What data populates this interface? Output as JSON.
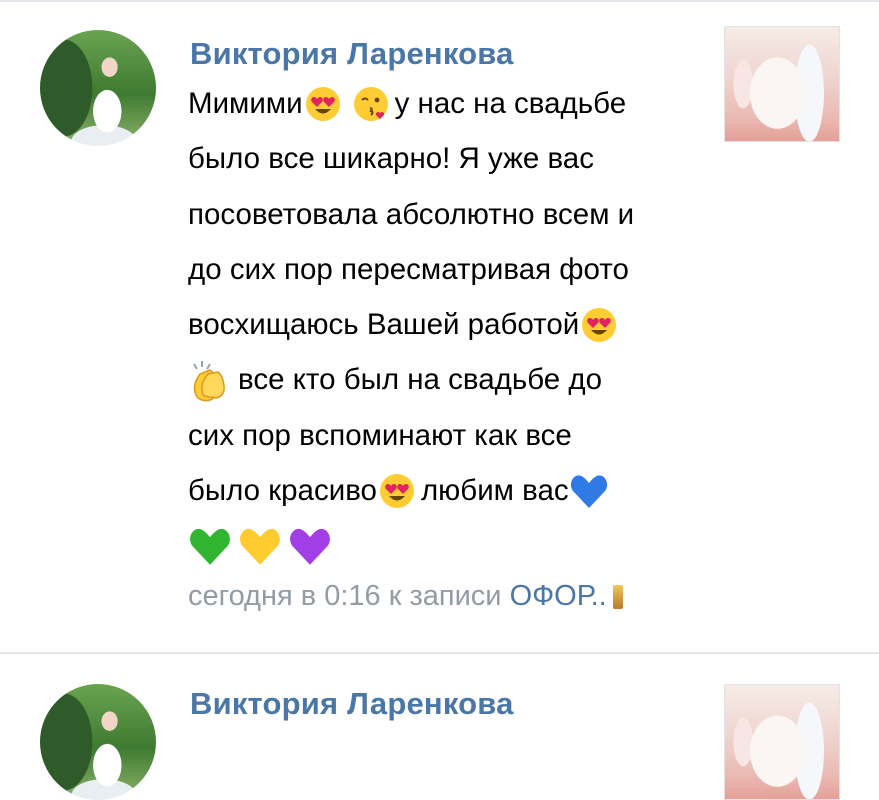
{
  "comments": [
    {
      "author": "Виктория Ларенкова",
      "lines": [
        [
          "Мимими",
          "",
          "",
          " у нас на свадьбе"
        ],
        [
          "было все шикарно! Я уже вас"
        ],
        [
          "посоветовала абсолютно всем и"
        ],
        [
          "до сих пор пересматривая фото"
        ],
        [
          "восхищаюсь Вашей работой"
        ],
        [
          "",
          " все кто был на свадьбе до"
        ],
        [
          "сих пор вспоминают как все"
        ],
        [
          "было красиво",
          "",
          " любим вас"
        ],
        [
          "",
          "",
          ""
        ]
      ],
      "time": "сегодня в 0:16",
      "post_prefix": "к записи",
      "post_link": "ОФОР.."
    },
    {
      "author": "Виктория Ларенкова"
    }
  ],
  "icons": {
    "heart_eyes": "heart-eyes-emoji",
    "kiss": "face-blowing-kiss-emoji",
    "clap": "clapping-hands-emoji",
    "blue_heart": "blue-heart-emoji",
    "green_heart": "green-heart-emoji",
    "yellow_heart": "yellow-heart-emoji",
    "purple_heart": "purple-heart-emoji"
  },
  "colors": {
    "author": "#4a76a8",
    "meta": "#939ba5",
    "link": "#4a76a8",
    "divider": "#e3e6ea"
  }
}
